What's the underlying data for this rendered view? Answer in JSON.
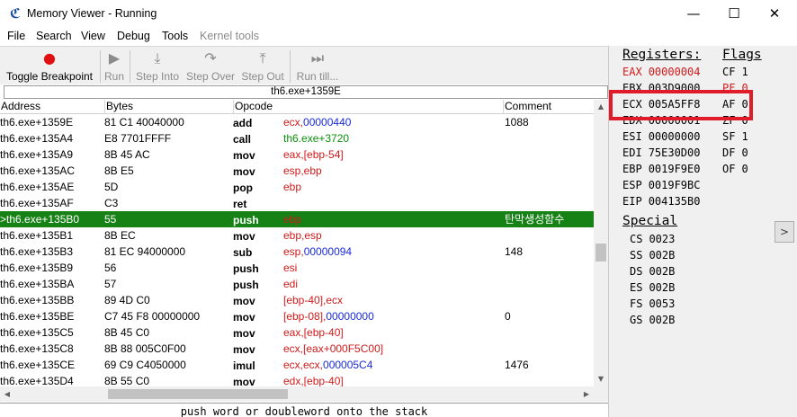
{
  "window": {
    "title": "Memory Viewer - Running",
    "icon": "cheat-engine-icon",
    "minimize": "—",
    "maximize": "☐",
    "close": "✕"
  },
  "menu": [
    "File",
    "Search",
    "View",
    "Debug",
    "Tools",
    "Kernel tools"
  ],
  "toolbar": {
    "toggle_breakpoint": "Toggle Breakpoint",
    "run": "Run",
    "step_into": "Step Into",
    "step_over": "Step Over",
    "step_out": "Step Out",
    "run_till": "Run till..."
  },
  "address_bar": "th6.exe+1359E",
  "columns": {
    "address": "Address",
    "bytes": "Bytes",
    "opcode": "Opcode",
    "comment": "Comment"
  },
  "rows": [
    {
      "addr": "th6.exe+1359E",
      "bytes": "81 C1 40040000",
      "op": "add",
      "args": [
        {
          "t": "ecx",
          "c": "red"
        },
        {
          "t": ",",
          "c": "red"
        },
        {
          "t": "00000440",
          "c": "blue"
        }
      ],
      "comment": "1088"
    },
    {
      "addr": "th6.exe+135A4",
      "bytes": "E8 7701FFFF",
      "op": "call",
      "args": [
        {
          "t": "th6.exe+3720",
          "c": "green"
        }
      ],
      "comment": ""
    },
    {
      "addr": "th6.exe+135A9",
      "bytes": "8B 45 AC",
      "op": "mov",
      "args": [
        {
          "t": "eax,[ebp-54]",
          "c": "red"
        }
      ],
      "comment": ""
    },
    {
      "addr": "th6.exe+135AC",
      "bytes": "8B E5",
      "op": "mov",
      "args": [
        {
          "t": "esp,ebp",
          "c": "red"
        }
      ],
      "comment": ""
    },
    {
      "addr": "th6.exe+135AE",
      "bytes": "5D",
      "op": "pop",
      "args": [
        {
          "t": "ebp",
          "c": "red"
        }
      ],
      "comment": ""
    },
    {
      "addr": "th6.exe+135AF",
      "bytes": "C3",
      "op": "ret",
      "args": [],
      "comment": ""
    },
    {
      "addr": ">th6.exe+135B0",
      "bytes": "55",
      "op": "push",
      "args": [
        {
          "t": "ebp",
          "c": "red"
        }
      ],
      "comment": "탄막생성함수",
      "selected": true
    },
    {
      "addr": "th6.exe+135B1",
      "bytes": "8B EC",
      "op": "mov",
      "args": [
        {
          "t": "ebp,esp",
          "c": "red"
        }
      ],
      "comment": ""
    },
    {
      "addr": "th6.exe+135B3",
      "bytes": "81 EC 94000000",
      "op": "sub",
      "args": [
        {
          "t": "esp",
          "c": "red"
        },
        {
          "t": ",",
          "c": "red"
        },
        {
          "t": "00000094",
          "c": "blue"
        }
      ],
      "comment": "148"
    },
    {
      "addr": "th6.exe+135B9",
      "bytes": "56",
      "op": "push",
      "args": [
        {
          "t": "esi",
          "c": "red"
        }
      ],
      "comment": ""
    },
    {
      "addr": "th6.exe+135BA",
      "bytes": "57",
      "op": "push",
      "args": [
        {
          "t": "edi",
          "c": "red"
        }
      ],
      "comment": ""
    },
    {
      "addr": "th6.exe+135BB",
      "bytes": "89 4D C0",
      "op": "mov",
      "args": [
        {
          "t": "[ebp-40],ecx",
          "c": "red"
        }
      ],
      "comment": ""
    },
    {
      "addr": "th6.exe+135BE",
      "bytes": "C7 45 F8 00000000",
      "op": "mov",
      "args": [
        {
          "t": "[ebp-08],",
          "c": "red"
        },
        {
          "t": "00000000",
          "c": "blue"
        }
      ],
      "comment": "0"
    },
    {
      "addr": "th6.exe+135C5",
      "bytes": "8B 45 C0",
      "op": "mov",
      "args": [
        {
          "t": "eax,[ebp-40]",
          "c": "red"
        }
      ],
      "comment": ""
    },
    {
      "addr": "th6.exe+135C8",
      "bytes": "8B 88 005C0F00",
      "op": "mov",
      "args": [
        {
          "t": "ecx,[eax+000F5C00]",
          "c": "red"
        }
      ],
      "comment": ""
    },
    {
      "addr": "th6.exe+135CE",
      "bytes": "69 C9 C4050000",
      "op": "imul",
      "args": [
        {
          "t": "ecx,ecx,",
          "c": "red"
        },
        {
          "t": "000005C4",
          "c": "blue"
        }
      ],
      "comment": "1476"
    },
    {
      "addr": "th6.exe+135D4",
      "bytes": "8B 55 C0",
      "op": "mov",
      "args": [
        {
          "t": "edx,[ebp-40]",
          "c": "red"
        }
      ],
      "comment": ""
    }
  ],
  "status_text": "push word or doubleword onto the stack",
  "registers_header": "Registers:",
  "flags_header": "Flags",
  "registers": [
    {
      "name": "EAX",
      "value": "00000004",
      "changed": true
    },
    {
      "name": "EBX",
      "value": "003D9000",
      "changed": false
    },
    {
      "name": "ECX",
      "value": "005A5FF8",
      "changed": false
    },
    {
      "name": "EDX",
      "value": "00000001",
      "changed": false
    },
    {
      "name": "ESI",
      "value": "00000000",
      "changed": false
    },
    {
      "name": "EDI",
      "value": "75E30D00",
      "changed": false
    },
    {
      "name": "EBP",
      "value": "0019F9E0",
      "changed": false
    },
    {
      "name": "ESP",
      "value": "0019F9BC",
      "changed": false
    },
    {
      "name": "EIP",
      "value": "004135B0",
      "changed": false
    }
  ],
  "flags": [
    {
      "name": "CF",
      "value": "1",
      "changed": false
    },
    {
      "name": "PF",
      "value": "0",
      "changed": true
    },
    {
      "name": "AF",
      "value": "0",
      "changed": false
    },
    {
      "name": "ZF",
      "value": "0",
      "changed": false
    },
    {
      "name": "SF",
      "value": "1",
      "changed": false
    },
    {
      "name": "DF",
      "value": "0",
      "changed": false
    },
    {
      "name": "OF",
      "value": "0",
      "changed": false
    }
  ],
  "special_header": "Special",
  "special": [
    {
      "name": "CS",
      "value": "0023"
    },
    {
      "name": "SS",
      "value": "002B"
    },
    {
      "name": "DS",
      "value": "002B"
    },
    {
      "name": "ES",
      "value": "002B"
    },
    {
      "name": "FS",
      "value": "0053"
    },
    {
      "name": "GS",
      "value": "002B"
    }
  ],
  "expand_button": ">",
  "colors": {
    "selected_row": "#168216",
    "register_red": "#d11a1a",
    "operand_red": "#d11a1a",
    "operand_blue": "#1a2bd6",
    "operand_green": "#0a8f0a",
    "highlight_box": "#e01c2a"
  }
}
